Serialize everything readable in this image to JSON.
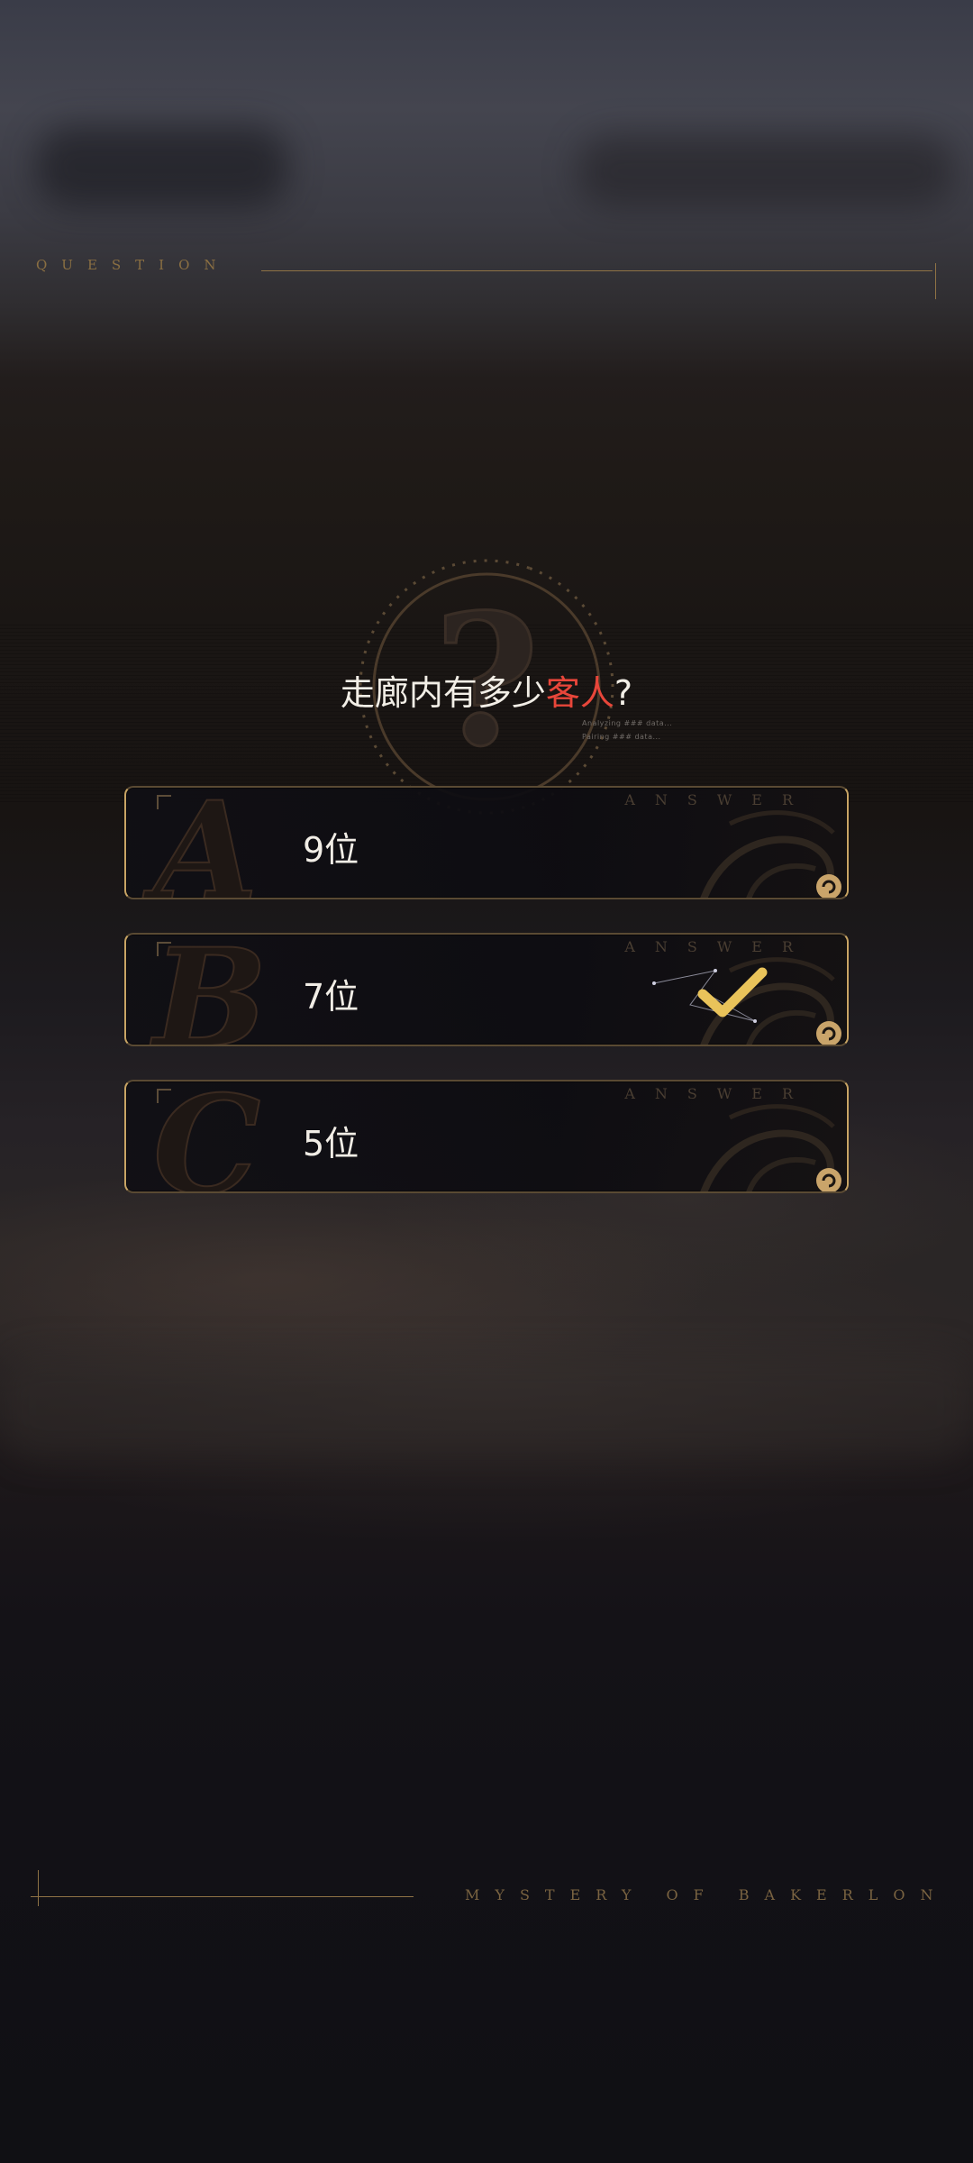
{
  "header": {
    "label": "QUESTION"
  },
  "question": {
    "text": "走廊内有多少",
    "highlight": "客人",
    "suffix": "?"
  },
  "hud": {
    "line1": "Analyzing ### data...",
    "line2": "Pairing ### data..."
  },
  "answers": {
    "header_word": "ANSWER",
    "options": [
      {
        "letter": "A",
        "label": "9位",
        "selected": false
      },
      {
        "letter": "B",
        "label": "7位",
        "selected": true
      },
      {
        "letter": "C",
        "label": "5位",
        "selected": false
      }
    ]
  },
  "footer": {
    "label": "MYSTERY OF BAKERLON"
  },
  "colors": {
    "gold": "#c8a464",
    "highlight": "#e8463a",
    "check": "#e9c35a"
  },
  "icons": {
    "selected_marker": "checkmark-icon",
    "emblem": "question-mark-icon",
    "corner_ornament": "swirl-ornament-icon"
  }
}
